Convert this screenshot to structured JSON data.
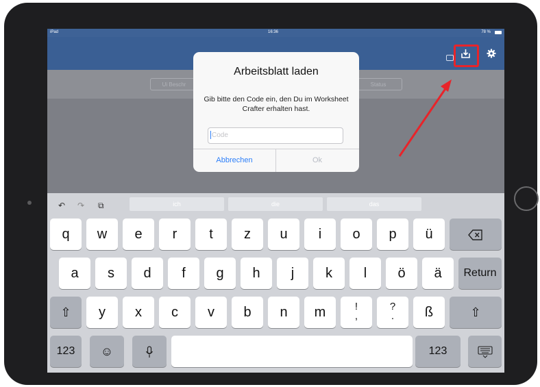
{
  "status_bar": {
    "device": "iPad",
    "time": "16:36",
    "battery": "78 %"
  },
  "toolbar": {
    "left_button": "Ui Beschr",
    "right_button": "Status"
  },
  "dialog": {
    "title": "Arbeitsblatt laden",
    "message": "Gib bitte den Code ein, den Du im Worksheet Crafter erhalten hast.",
    "input_placeholder": "Code",
    "cancel_label": "Abbrechen",
    "ok_label": "Ok"
  },
  "keyboard": {
    "suggestions": [
      "ich",
      "die",
      "das"
    ],
    "row1": [
      "q",
      "w",
      "e",
      "r",
      "t",
      "z",
      "u",
      "i",
      "o",
      "p",
      "ü"
    ],
    "row2": [
      "a",
      "s",
      "d",
      "f",
      "g",
      "h",
      "j",
      "k",
      "l",
      "ö",
      "ä"
    ],
    "row3": [
      "y",
      "x",
      "c",
      "v",
      "b",
      "n",
      "m",
      "!\n,",
      "?\n.",
      "ß"
    ],
    "return_label": "Return",
    "numbers_label": "123"
  },
  "colors": {
    "navbar": "#3a5f94",
    "highlight": "#e8242a",
    "link": "#2d7ff9"
  },
  "icons": {
    "download": "download-icon",
    "settings": "gear-icon",
    "highlight_arrow": "red-arrow"
  }
}
